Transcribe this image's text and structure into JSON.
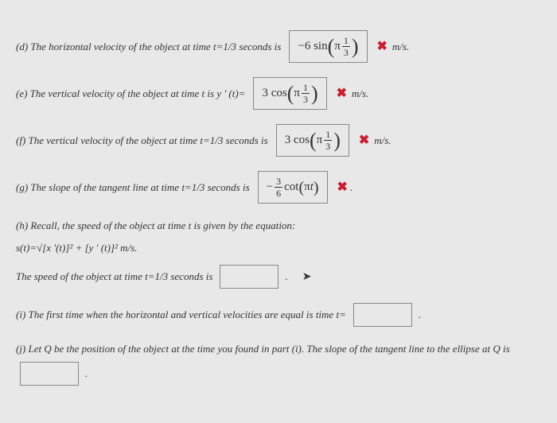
{
  "d": {
    "prompt": "(d) The horizontal velocity of the object at time t=1/3 seconds is",
    "answer": "-6 sin(π 1/3)",
    "unit": "m/s."
  },
  "e": {
    "prompt": "(e) The vertical velocity of the object at time t is y ' (t)=",
    "answer": "3 cos(π 1/3)",
    "unit": "m/s."
  },
  "f": {
    "prompt": "(f) The vertical velocity of the object at time t=1/3 seconds is",
    "answer": "3 cos(π 1/3)",
    "unit": "m/s."
  },
  "g": {
    "prompt": "(g) The slope of the tangent line at time t=1/3 seconds is",
    "answer": "− (3/6) cot(πt)"
  },
  "h": {
    "recall": "(h) Recall, the speed of the object at time t is given by the equation:",
    "equation": "s(t)=√[x '(t)]² + [y ' (t)]² m/s.",
    "prompt": "The speed of the object at time t=1/3 seconds is"
  },
  "i": {
    "prompt": "(i) The first time when the horizontal and vertical velocities are equal is time t="
  },
  "j": {
    "prompt": "(j) Let Q be the position of the object at the time you found in part (i). The slope of the tangent line to the ellipse at Q is"
  }
}
